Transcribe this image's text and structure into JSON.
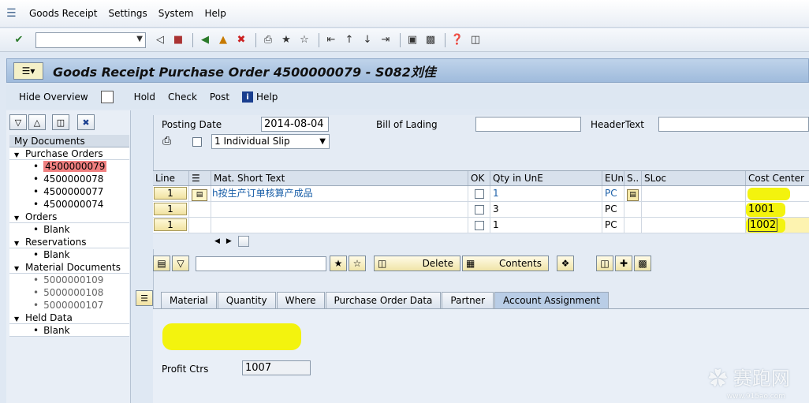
{
  "menu": [
    {
      "label": "Goods Receipt",
      "mnemonic": "G"
    },
    {
      "label": "Settings",
      "mnemonic": "S"
    },
    {
      "label": "System",
      "mnemonic": "S"
    },
    {
      "label": "Help",
      "mnemonic": "H"
    }
  ],
  "title": "Goods Receipt Purchase Order 4500000079 - S082刘佳",
  "app_toolbar": {
    "hide_overview": "Hide Overview",
    "hold": "Hold",
    "check": "Check",
    "post": "Post",
    "help": "Help"
  },
  "left_panel": {
    "header": "My Documents",
    "groups": [
      {
        "label": "Purchase Orders",
        "items": [
          "4500000079",
          "4500000078",
          "4500000077",
          "4500000074"
        ]
      },
      {
        "label": "Orders",
        "items": [
          "Blank"
        ]
      },
      {
        "label": "Reservations",
        "items": [
          "Blank"
        ]
      },
      {
        "label": "Material Documents",
        "items": [
          "5000000109",
          "5000000108",
          "5000000107"
        ]
      },
      {
        "label": "Held Data",
        "items": [
          "Blank"
        ]
      }
    ]
  },
  "header_fields": {
    "posting_date_label": "Posting Date",
    "posting_date_value": "2014-08-04",
    "bill_of_lading_label": "Bill of Lading",
    "bill_of_lading_value": "",
    "header_text_label": "HeaderText",
    "header_text_value": "",
    "slip_option": "1 Individual Slip"
  },
  "grid": {
    "columns": [
      "Line",
      "",
      "Mat. Short Text",
      "OK",
      "Qty in UnE",
      "EUn",
      "S..",
      "SLoc",
      "Cost Center"
    ],
    "rows": [
      {
        "line": "1",
        "text": "h按生产订单核算产成品",
        "qty": "1",
        "eun": "PC",
        "cost_center": ""
      },
      {
        "line": "1",
        "text": "",
        "qty": "3",
        "eun": "PC",
        "cost_center": "1001"
      },
      {
        "line": "1",
        "text": "",
        "qty": "1",
        "eun": "PC",
        "cost_center": "1002"
      }
    ]
  },
  "grid_tools": {
    "delete_label": "Delete",
    "contents_label": "Contents"
  },
  "tabs": [
    {
      "label": "Material",
      "active": false
    },
    {
      "label": "Quantity",
      "active": false
    },
    {
      "label": "Where",
      "active": false
    },
    {
      "label": "Purchase Order Data",
      "active": false
    },
    {
      "label": "Partner",
      "active": false
    },
    {
      "label": "Account Assignment",
      "active": true
    }
  ],
  "account_assignment": {
    "profit_ctr_label": "Profit Ctrs",
    "profit_ctr_value": "1007"
  },
  "watermark": {
    "text": "赛跑网",
    "sub": "www.915ao.com"
  },
  "colors": {
    "selected_tree_item": "#f08080",
    "highlight": "#f5f515",
    "title_bar": "#a9c2e0"
  }
}
